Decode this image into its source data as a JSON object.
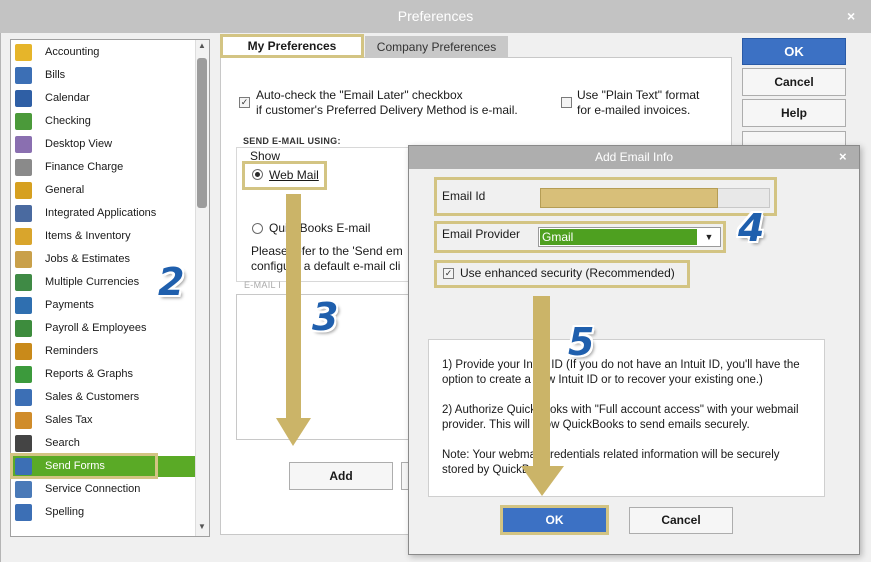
{
  "window": {
    "title": "Preferences",
    "close_icon": "×"
  },
  "sidebar": {
    "items": [
      {
        "label": "Accounting",
        "icon": "accounting-icon",
        "color": "#e6b52a"
      },
      {
        "label": "Bills",
        "icon": "bills-icon",
        "color": "#3c6fb5"
      },
      {
        "label": "Calendar",
        "icon": "calendar-icon",
        "color": "#2f5fa5"
      },
      {
        "label": "Checking",
        "icon": "checking-icon",
        "color": "#4b9a3a"
      },
      {
        "label": "Desktop View",
        "icon": "desktop-view-icon",
        "color": "#8a6fb0"
      },
      {
        "label": "Finance Charge",
        "icon": "finance-charge-icon",
        "color": "#8a8a8a"
      },
      {
        "label": "General",
        "icon": "general-icon",
        "color": "#d6a020"
      },
      {
        "label": "Integrated Applications",
        "icon": "integrated-applications-icon",
        "color": "#4a6aa0"
      },
      {
        "label": "Items & Inventory",
        "icon": "items-inventory-icon",
        "color": "#d9a52c"
      },
      {
        "label": "Jobs & Estimates",
        "icon": "jobs-estimates-icon",
        "color": "#c9a04a"
      },
      {
        "label": "Multiple Currencies",
        "icon": "multiple-currencies-icon",
        "color": "#3f8a45"
      },
      {
        "label": "Payments",
        "icon": "payments-icon",
        "color": "#2f6fb0"
      },
      {
        "label": "Payroll & Employees",
        "icon": "payroll-employees-icon",
        "color": "#3d8c3d"
      },
      {
        "label": "Reminders",
        "icon": "reminders-icon",
        "color": "#c98a1a"
      },
      {
        "label": "Reports & Graphs",
        "icon": "reports-graphs-icon",
        "color": "#3c9a3c"
      },
      {
        "label": "Sales & Customers",
        "icon": "sales-customers-icon",
        "color": "#3c6fb5"
      },
      {
        "label": "Sales Tax",
        "icon": "sales-tax-icon",
        "color": "#d08c2a"
      },
      {
        "label": "Search",
        "icon": "search-icon",
        "color": "#444444"
      },
      {
        "label": "Send Forms",
        "icon": "send-forms-icon",
        "color": "#3c6fb5",
        "selected": true
      },
      {
        "label": "Service Connection",
        "icon": "service-connection-icon",
        "color": "#4a7ab8"
      },
      {
        "label": "Spelling",
        "icon": "spelling-icon",
        "color": "#3c6fb5"
      }
    ]
  },
  "tabs": {
    "my_preferences": "My Preferences",
    "company_preferences": "Company Preferences"
  },
  "main": {
    "auto_check_line1": "Auto-check the \"Email Later\" checkbox",
    "auto_check_line2": "if customer's Preferred Delivery Method is e-mail.",
    "plain_text_line1": "Use \"Plain Text\" format",
    "plain_text_line2": "for e-mailed invoices.",
    "send_email_using": "SEND E-MAIL USING:",
    "show_label": "Show",
    "web_mail": "Web Mail",
    "quickbooks_email": "QuickBooks E-mail",
    "refer_line1": "Please refer to the 'Send em",
    "refer_line2": "configure a default e-mail cli",
    "email_ids_label": "E-MAIL I",
    "add_button": "Add"
  },
  "buttons": {
    "ok": "OK",
    "cancel": "Cancel",
    "help": "Help"
  },
  "dialog": {
    "title": "Add Email Info",
    "close_icon": "×",
    "email_id_label": "Email Id",
    "email_id_value": "",
    "email_provider_label": "Email Provider",
    "email_provider_value": "Gmail",
    "security_label": "Use enhanced security (Recommended)",
    "info_1_line1": "1) Provide your Intuit ID (If you do not have an Intuit ID, you'll have the",
    "info_1_line2": "option to create a new Intuit ID or to recover your existing one.)",
    "info_2_line1": "2) Authorize QuickBooks with \"Full account access\" with your webmail",
    "info_2_line2": "provider. This will allow QuickBooks to send emails securely.",
    "note_line1": "Note: Your webmail credentials related  information will be  securely",
    "note_line2": "stored by QuickBooks.",
    "ok": "OK",
    "cancel": "Cancel"
  },
  "annotations": {
    "step2": "2",
    "step3": "3",
    "step4": "4",
    "step5": "5"
  },
  "colors": {
    "highlight": "#d3c483",
    "arrow": "#cbb468",
    "select_green": "#5aaa26",
    "ok_blue": "#3c71c4",
    "step_number": "#1f5fad"
  }
}
